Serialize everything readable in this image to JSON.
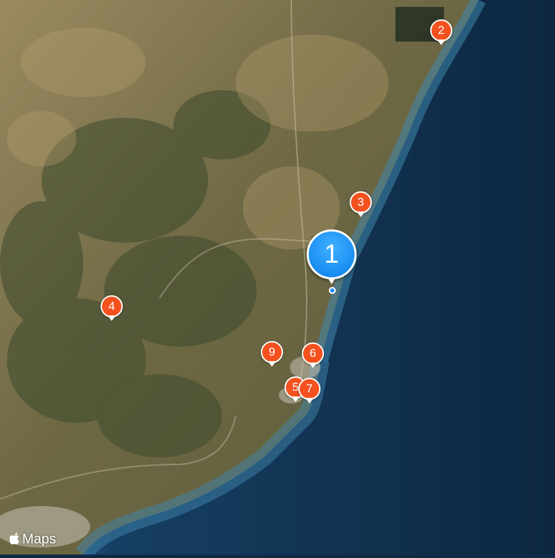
{
  "map": {
    "attribution": "Maps",
    "attribution_icon": "apple-icon",
    "colors": {
      "sea": "#0f2a45",
      "land": "#7a6f4e",
      "pin_marker": "#f4511e",
      "selected_marker": "#1a8ef2"
    },
    "markers": [
      {
        "label": "1",
        "style": "selected"
      },
      {
        "label": "2",
        "style": "default"
      },
      {
        "label": "3",
        "style": "default"
      },
      {
        "label": "4",
        "style": "default"
      },
      {
        "label": "5",
        "style": "default"
      },
      {
        "label": "6",
        "style": "default"
      },
      {
        "label": "7",
        "style": "default"
      },
      {
        "label": "9",
        "style": "default"
      }
    ]
  }
}
